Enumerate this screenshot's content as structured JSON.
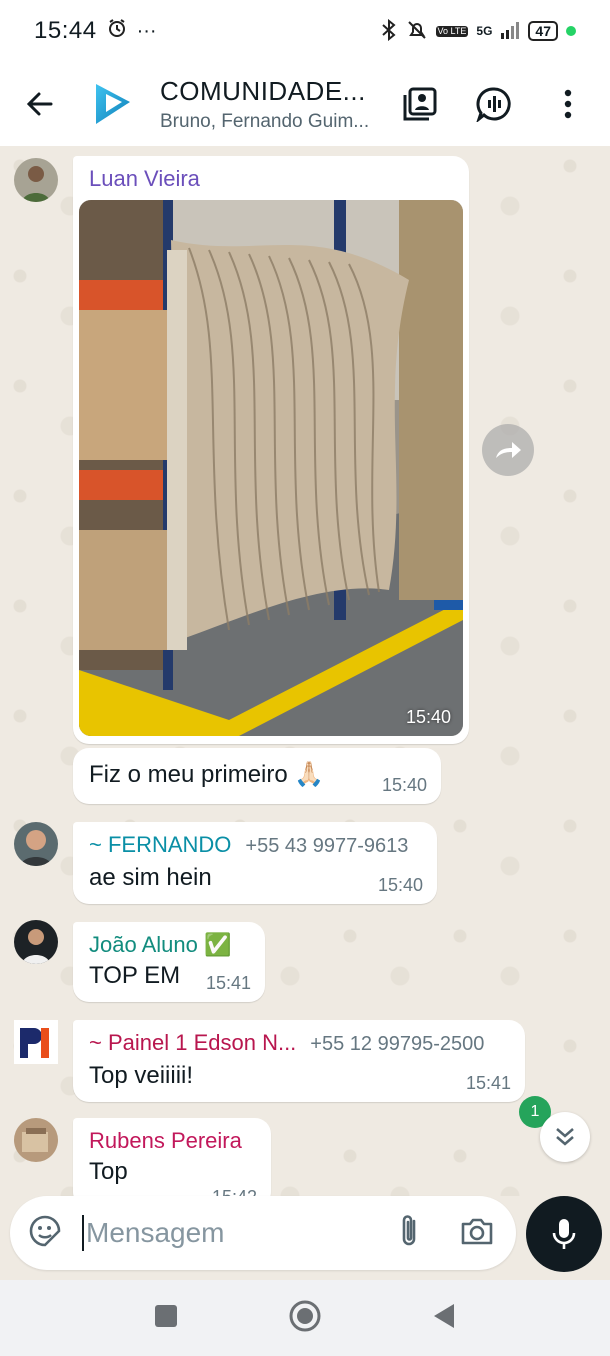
{
  "status_bar": {
    "time": "15:44",
    "alarm_icon": "alarm-icon",
    "more": "···",
    "network": "5G",
    "volte": "Vo LTE",
    "battery": "47"
  },
  "header": {
    "title": "COMUNIDADE...",
    "subtitle": "Bruno, Fernando Guim...",
    "icons": [
      "back-arrow-icon",
      "group-avatar",
      "gallery-icon",
      "voice-chat-icon",
      "more-vert-icon"
    ]
  },
  "messages": [
    {
      "sender": "Luan Vieira",
      "sender_color": "#6b4fbb",
      "type": "image",
      "time": "15:40"
    },
    {
      "text": "Fiz o meu primeiro 🙏🏻",
      "time": "15:40"
    },
    {
      "sender": "~ FERNANDO",
      "phone": "+55 43 9977-9613",
      "sender_color": "#0a8fa6",
      "text": "ae sim hein",
      "time": "15:40"
    },
    {
      "sender": "João Aluno ✅",
      "sender_color": "#128c7e",
      "text": "TOP EM",
      "time": "15:41"
    },
    {
      "sender": "~ Painel 1 Edson N...",
      "phone": "+55 12 99795-2500",
      "sender_color": "#b8164e",
      "text": "Top veiiiii!",
      "time": "15:41"
    },
    {
      "sender": "Rubens Pereira",
      "sender_color": "#c2185b",
      "text": "Top",
      "time": "15:42"
    }
  ],
  "scroll": {
    "unread_count": "1"
  },
  "input": {
    "placeholder": "Mensagem"
  },
  "colors": {
    "accent": "#25d366",
    "background": "#efeae2"
  }
}
